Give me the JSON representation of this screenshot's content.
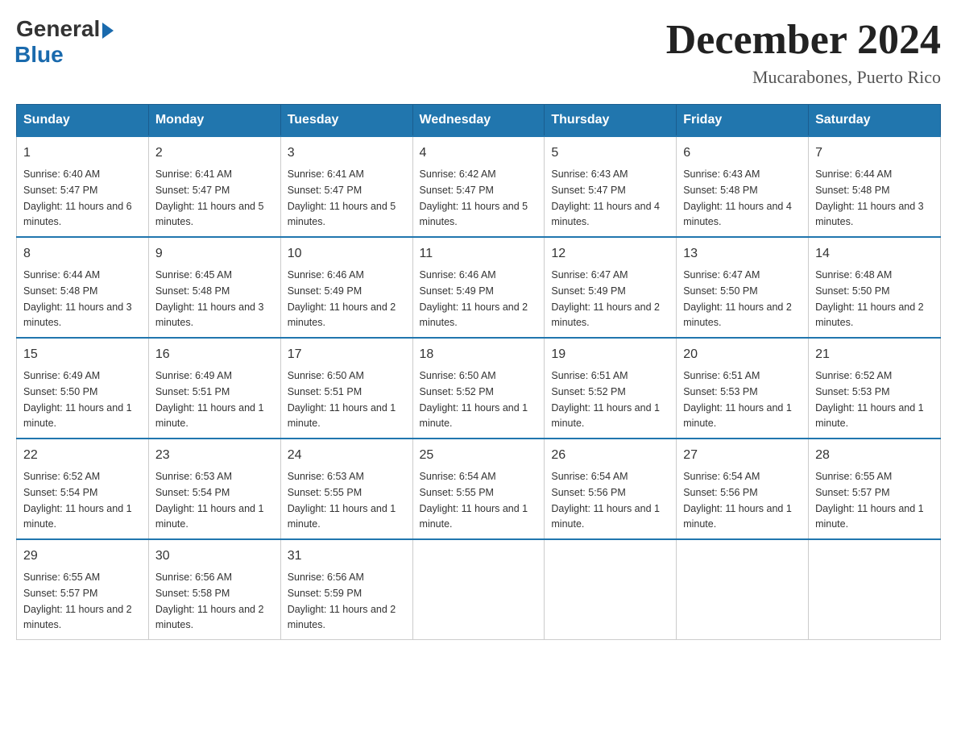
{
  "logo": {
    "general": "General",
    "blue": "Blue"
  },
  "title": "December 2024",
  "location": "Mucarabones, Puerto Rico",
  "days_of_week": [
    "Sunday",
    "Monday",
    "Tuesday",
    "Wednesday",
    "Thursday",
    "Friday",
    "Saturday"
  ],
  "weeks": [
    [
      {
        "day": "1",
        "sunrise": "6:40 AM",
        "sunset": "5:47 PM",
        "daylight": "11 hours and 6 minutes."
      },
      {
        "day": "2",
        "sunrise": "6:41 AM",
        "sunset": "5:47 PM",
        "daylight": "11 hours and 5 minutes."
      },
      {
        "day": "3",
        "sunrise": "6:41 AM",
        "sunset": "5:47 PM",
        "daylight": "11 hours and 5 minutes."
      },
      {
        "day": "4",
        "sunrise": "6:42 AM",
        "sunset": "5:47 PM",
        "daylight": "11 hours and 5 minutes."
      },
      {
        "day": "5",
        "sunrise": "6:43 AM",
        "sunset": "5:47 PM",
        "daylight": "11 hours and 4 minutes."
      },
      {
        "day": "6",
        "sunrise": "6:43 AM",
        "sunset": "5:48 PM",
        "daylight": "11 hours and 4 minutes."
      },
      {
        "day": "7",
        "sunrise": "6:44 AM",
        "sunset": "5:48 PM",
        "daylight": "11 hours and 3 minutes."
      }
    ],
    [
      {
        "day": "8",
        "sunrise": "6:44 AM",
        "sunset": "5:48 PM",
        "daylight": "11 hours and 3 minutes."
      },
      {
        "day": "9",
        "sunrise": "6:45 AM",
        "sunset": "5:48 PM",
        "daylight": "11 hours and 3 minutes."
      },
      {
        "day": "10",
        "sunrise": "6:46 AM",
        "sunset": "5:49 PM",
        "daylight": "11 hours and 2 minutes."
      },
      {
        "day": "11",
        "sunrise": "6:46 AM",
        "sunset": "5:49 PM",
        "daylight": "11 hours and 2 minutes."
      },
      {
        "day": "12",
        "sunrise": "6:47 AM",
        "sunset": "5:49 PM",
        "daylight": "11 hours and 2 minutes."
      },
      {
        "day": "13",
        "sunrise": "6:47 AM",
        "sunset": "5:50 PM",
        "daylight": "11 hours and 2 minutes."
      },
      {
        "day": "14",
        "sunrise": "6:48 AM",
        "sunset": "5:50 PM",
        "daylight": "11 hours and 2 minutes."
      }
    ],
    [
      {
        "day": "15",
        "sunrise": "6:49 AM",
        "sunset": "5:50 PM",
        "daylight": "11 hours and 1 minute."
      },
      {
        "day": "16",
        "sunrise": "6:49 AM",
        "sunset": "5:51 PM",
        "daylight": "11 hours and 1 minute."
      },
      {
        "day": "17",
        "sunrise": "6:50 AM",
        "sunset": "5:51 PM",
        "daylight": "11 hours and 1 minute."
      },
      {
        "day": "18",
        "sunrise": "6:50 AM",
        "sunset": "5:52 PM",
        "daylight": "11 hours and 1 minute."
      },
      {
        "day": "19",
        "sunrise": "6:51 AM",
        "sunset": "5:52 PM",
        "daylight": "11 hours and 1 minute."
      },
      {
        "day": "20",
        "sunrise": "6:51 AM",
        "sunset": "5:53 PM",
        "daylight": "11 hours and 1 minute."
      },
      {
        "day": "21",
        "sunrise": "6:52 AM",
        "sunset": "5:53 PM",
        "daylight": "11 hours and 1 minute."
      }
    ],
    [
      {
        "day": "22",
        "sunrise": "6:52 AM",
        "sunset": "5:54 PM",
        "daylight": "11 hours and 1 minute."
      },
      {
        "day": "23",
        "sunrise": "6:53 AM",
        "sunset": "5:54 PM",
        "daylight": "11 hours and 1 minute."
      },
      {
        "day": "24",
        "sunrise": "6:53 AM",
        "sunset": "5:55 PM",
        "daylight": "11 hours and 1 minute."
      },
      {
        "day": "25",
        "sunrise": "6:54 AM",
        "sunset": "5:55 PM",
        "daylight": "11 hours and 1 minute."
      },
      {
        "day": "26",
        "sunrise": "6:54 AM",
        "sunset": "5:56 PM",
        "daylight": "11 hours and 1 minute."
      },
      {
        "day": "27",
        "sunrise": "6:54 AM",
        "sunset": "5:56 PM",
        "daylight": "11 hours and 1 minute."
      },
      {
        "day": "28",
        "sunrise": "6:55 AM",
        "sunset": "5:57 PM",
        "daylight": "11 hours and 1 minute."
      }
    ],
    [
      {
        "day": "29",
        "sunrise": "6:55 AM",
        "sunset": "5:57 PM",
        "daylight": "11 hours and 2 minutes."
      },
      {
        "day": "30",
        "sunrise": "6:56 AM",
        "sunset": "5:58 PM",
        "daylight": "11 hours and 2 minutes."
      },
      {
        "day": "31",
        "sunrise": "6:56 AM",
        "sunset": "5:59 PM",
        "daylight": "11 hours and 2 minutes."
      },
      null,
      null,
      null,
      null
    ]
  ]
}
